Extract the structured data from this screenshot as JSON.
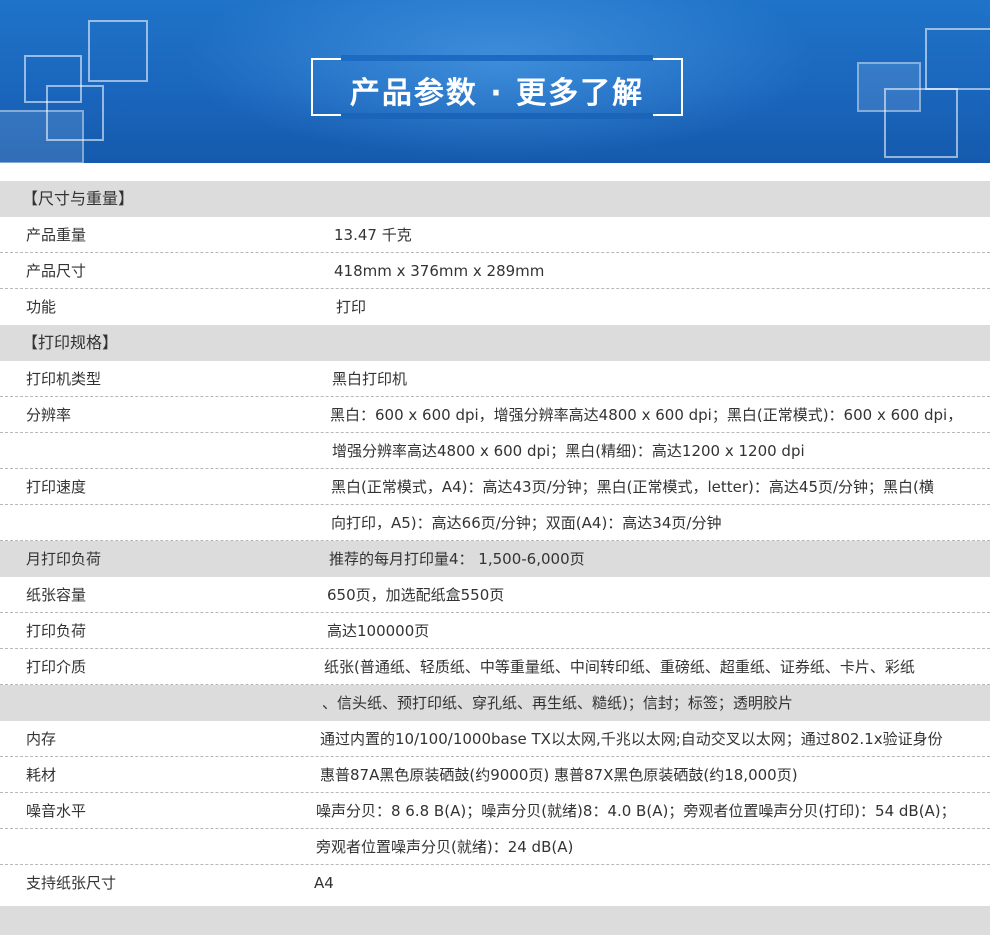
{
  "banner": {
    "title": "产品参数 · 更多了解"
  },
  "rows": [
    {
      "kind": "section",
      "label": "【尺寸与重量】",
      "value": ""
    },
    {
      "kind": "item",
      "label": "产品重量",
      "value": "13.47 千克"
    },
    {
      "kind": "item",
      "label": "产品尺寸",
      "value": "418mm x 376mm x 289mm"
    },
    {
      "kind": "item",
      "label": "功能",
      "value": "打印"
    },
    {
      "kind": "section",
      "label": "【打印规格】",
      "value": ""
    },
    {
      "kind": "item",
      "label": "打印机类型",
      "value": "黑白打印机"
    },
    {
      "kind": "item",
      "label": "分辨率",
      "value": "黑白：600 x 600 dpi，增强分辨率高达4800 x 600 dpi；黑白(正常模式)：600 x 600 dpi，"
    },
    {
      "kind": "cont",
      "label": "",
      "value": "增强分辨率高达4800 x 600 dpi；黑白(精细)：高达1200 x 1200 dpi"
    },
    {
      "kind": "item",
      "label": "打印速度",
      "value": "黑白(正常模式，A4)：高达43页/分钟；黑白(正常模式，letter)：高达45页/分钟；黑白(横"
    },
    {
      "kind": "cont",
      "label": "",
      "value": "向打印，A5)：高达66页/分钟；双面(A4)：高达34页/分钟"
    },
    {
      "kind": "item",
      "label": "月打印负荷",
      "value": "推荐的每月打印量4： 1,500-6,000页"
    },
    {
      "kind": "item",
      "label": "纸张容量",
      "value": "650页，加选配纸盒550页"
    },
    {
      "kind": "item",
      "label": "打印负荷",
      "value": "高达100000页"
    },
    {
      "kind": "item",
      "label": "打印介质",
      "value": "纸张(普通纸、轻质纸、中等重量纸、中间转印纸、重磅纸、超重纸、证券纸、卡片、彩纸"
    },
    {
      "kind": "cont",
      "label": "",
      "value": "、信头纸、预打印纸、穿孔纸、再生纸、糙纸)；信封；标签；透明胶片"
    },
    {
      "kind": "item",
      "label": "内存",
      "value": "通过内置的10/100/1000base TX以太网,千兆以太网;自动交叉以太网；通过802.1x验证身份"
    },
    {
      "kind": "item",
      "label": "耗材",
      "value": "惠普87A黑色原装硒鼓(约9000页) 惠普87X黑色原装硒鼓(约18,000页)"
    },
    {
      "kind": "item",
      "label": "噪音水平",
      "value": "噪声分贝：8 6.8 B(A)；噪声分贝(就绪)8：4.0 B(A)；旁观者位置噪声分贝(打印)：54 dB(A)；"
    },
    {
      "kind": "cont",
      "label": "",
      "value": "旁观者位置噪声分贝(就绪)：24 dB(A)"
    },
    {
      "kind": "item",
      "label": "支持纸张尺寸",
      "value": "A4"
    }
  ]
}
